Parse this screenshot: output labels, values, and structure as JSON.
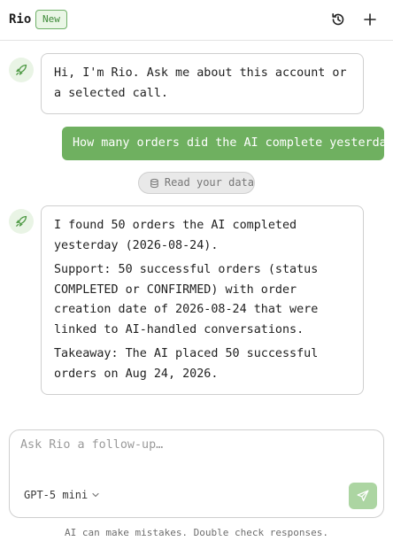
{
  "header": {
    "brand": "Rio",
    "badge": "New",
    "history_icon": "history-icon",
    "new_chat_icon": "plus-icon"
  },
  "messages": [
    {
      "role": "assistant",
      "avatar_icon": "rocket-icon",
      "paragraphs": [
        "Hi, I'm Rio. Ask me about this account or a selected call."
      ]
    },
    {
      "role": "user",
      "text": "How many orders did the AI complete yesterday?"
    },
    {
      "role": "tool",
      "icon": "database-icon",
      "label": "Read your data"
    },
    {
      "role": "assistant",
      "avatar_icon": "rocket-icon",
      "paragraphs": [
        "I found 50 orders the AI completed yesterday (2026-08-24).",
        "Support: 50 successful orders (status COMPLETED or CONFIRMED) with order creation date of 2026-08-24 that were linked to AI-handled conversations.",
        "Takeaway: The AI placed 50 successful orders on Aug 24, 2026."
      ]
    }
  ],
  "composer": {
    "placeholder": "Ask Rio a follow-up…",
    "value": "",
    "model": "GPT-5 mini",
    "send_icon": "send-icon"
  },
  "disclaimer": "AI can make mistakes. Double check responses.",
  "colors": {
    "accent": "#6fb060",
    "accent_light": "#e9f4e5",
    "send_disabled": "#acd5a2"
  }
}
